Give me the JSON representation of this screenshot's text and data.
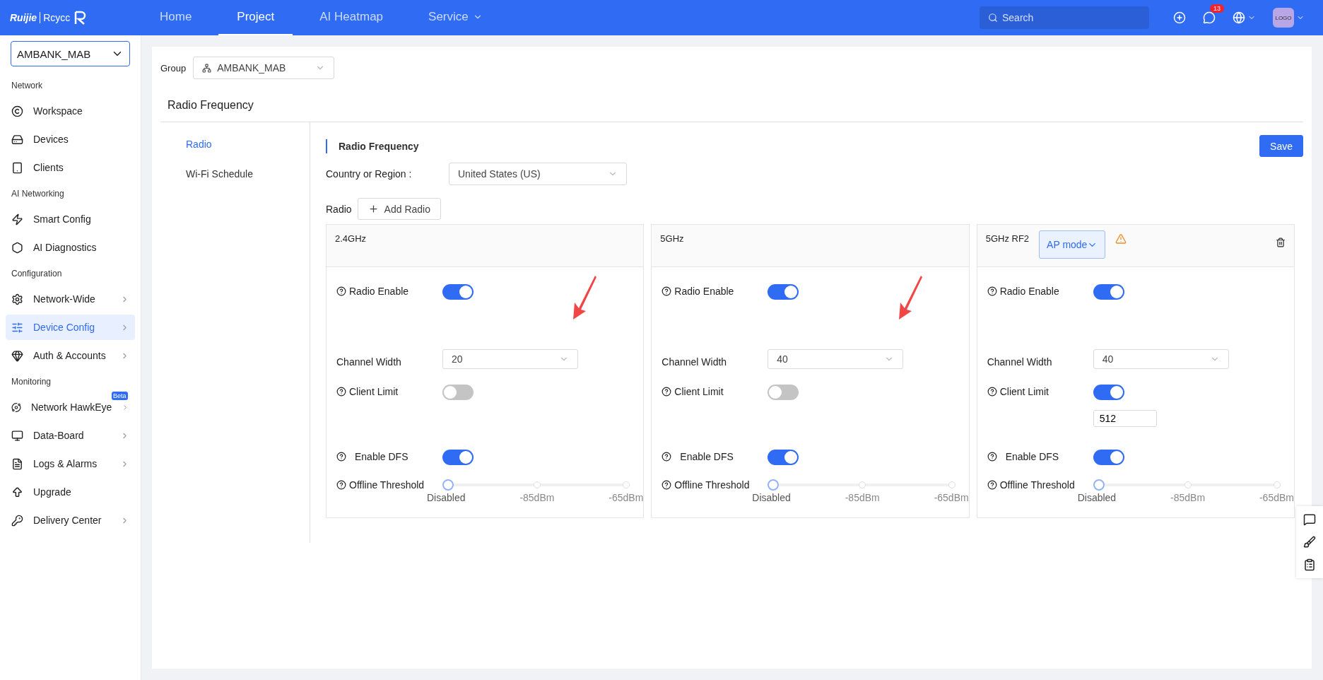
{
  "topbar": {
    "logo_text": "Ruijie",
    "logo_brand": "Rcycc",
    "nav": [
      {
        "label": "Home",
        "selected": false,
        "dropdown": false
      },
      {
        "label": "Project",
        "selected": true,
        "dropdown": false
      },
      {
        "label": "AI Heatmap",
        "selected": false,
        "dropdown": false
      },
      {
        "label": "Service",
        "selected": false,
        "dropdown": true
      }
    ],
    "search": {
      "placeholder": "Search"
    },
    "notification_count": "13",
    "avatar": "LOGO"
  },
  "sidebar": {
    "project": "AMBANK_MAB",
    "sections": [
      {
        "title": "Network",
        "items": [
          {
            "label": "Workspace",
            "selected": false,
            "submenu": false
          },
          {
            "label": "Devices",
            "selected": false,
            "submenu": false
          },
          {
            "label": "Clients",
            "selected": false,
            "submenu": false
          }
        ]
      },
      {
        "title": "AI Networking",
        "items": [
          {
            "label": "Smart Config",
            "selected": false,
            "submenu": false
          },
          {
            "label": "AI Diagnostics",
            "selected": false,
            "submenu": false
          }
        ]
      },
      {
        "title": "Configuration",
        "items": [
          {
            "label": "Network-Wide",
            "selected": false,
            "submenu": true
          },
          {
            "label": "Device Config",
            "selected": true,
            "submenu": true
          },
          {
            "label": "Auth & Accounts",
            "selected": false,
            "submenu": true
          }
        ]
      },
      {
        "title": "Monitoring",
        "items": [
          {
            "label": "Network HawkEye",
            "selected": false,
            "submenu": true,
            "badge": "Beta"
          },
          {
            "label": "Data-Board",
            "selected": false,
            "submenu": true
          },
          {
            "label": "Logs & Alarms",
            "selected": false,
            "submenu": true
          },
          {
            "label": "Upgrade",
            "selected": false,
            "submenu": false
          },
          {
            "label": "Delivery Center",
            "selected": false,
            "submenu": true
          }
        ]
      }
    ]
  },
  "group": {
    "label": "Group",
    "value": "AMBANK_MAB"
  },
  "page_title": "Radio Frequency",
  "subnav": [
    {
      "label": "Radio",
      "selected": true
    },
    {
      "label": "Wi-Fi Schedule",
      "selected": false
    }
  ],
  "section_title": "Radio Frequency",
  "save": {
    "label": "Save",
    "kind": "primary"
  },
  "country": {
    "label": "Country or Region :",
    "value": "United States (US)"
  },
  "radio_label": "Radio",
  "add_radio": {
    "label": "Add Radio",
    "kind": "outline",
    "disabled": false
  },
  "radios": [
    {
      "name": "2.4GHz",
      "warning": false,
      "deletable": false,
      "annotated": true,
      "fields": [
        {
          "kind": "toggle",
          "label": "Radio Enable",
          "help": true,
          "on": true
        },
        {
          "kind": "select",
          "label": "Channel Width",
          "help": false,
          "value": "20"
        },
        {
          "kind": "toggle",
          "label": "Client Limit",
          "help": true,
          "on": false
        },
        {
          "kind": "toggle",
          "label": "Enable DFS",
          "help": true,
          "on": true
        },
        {
          "kind": "slider",
          "label": "Offline Threshold",
          "help": true,
          "level": 0,
          "marks": [
            "Disabled",
            "-85dBm",
            "-65dBm"
          ]
        }
      ]
    },
    {
      "name": "5GHz",
      "warning": false,
      "deletable": false,
      "annotated": true,
      "fields": [
        {
          "kind": "toggle",
          "label": "Radio Enable",
          "help": true,
          "on": true
        },
        {
          "kind": "select",
          "label": "Channel Width",
          "help": false,
          "value": "40"
        },
        {
          "kind": "toggle",
          "label": "Client Limit",
          "help": true,
          "on": false
        },
        {
          "kind": "toggle",
          "label": "Enable DFS",
          "help": true,
          "on": true
        },
        {
          "kind": "slider",
          "label": "Offline Threshold",
          "help": true,
          "level": 0,
          "marks": [
            "Disabled",
            "-85dBm",
            "-65dBm"
          ]
        }
      ]
    },
    {
      "name": "5GHz RF2",
      "mode": "AP mode",
      "warning": true,
      "deletable": true,
      "annotated": false,
      "fields": [
        {
          "kind": "toggle",
          "label": "Radio Enable",
          "help": true,
          "on": true
        },
        {
          "kind": "select",
          "label": "Channel Width",
          "help": false,
          "value": "40"
        },
        {
          "kind": "toggle",
          "label": "Client Limit",
          "help": true,
          "on": true,
          "value": "512"
        },
        {
          "kind": "toggle",
          "label": "Enable DFS",
          "help": true,
          "on": true
        },
        {
          "kind": "slider",
          "label": "Offline Threshold",
          "help": true,
          "level": 0,
          "marks": [
            "Disabled",
            "-85dBm",
            "-65dBm"
          ]
        }
      ]
    }
  ]
}
